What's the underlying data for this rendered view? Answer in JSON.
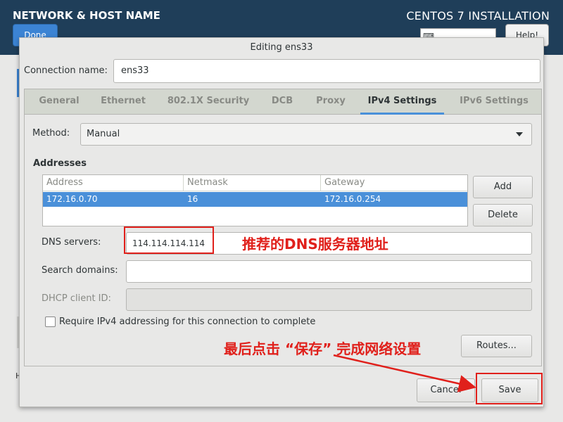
{
  "header": {
    "title": "NETWORK & HOST NAME",
    "done_label": "Done",
    "installer_label": "CENTOS 7 INSTALLATION",
    "help_label": "Help!",
    "bg_h": "H"
  },
  "dialog": {
    "title": "Editing ens33",
    "connection_name_label": "Connection name:",
    "connection_name_value": "ens33",
    "tabs": [
      "General",
      "Ethernet",
      "802.1X Security",
      "DCB",
      "Proxy",
      "IPv4 Settings",
      "IPv6 Settings"
    ],
    "active_tab": "IPv4 Settings",
    "method_label": "Method:",
    "method_value": "Manual",
    "addresses_title": "Addresses",
    "addresses": {
      "columns": [
        "Address",
        "Netmask",
        "Gateway"
      ],
      "rows": [
        [
          "172.16.0.70",
          "16",
          "172.16.0.254"
        ]
      ]
    },
    "add_label": "Add",
    "delete_label": "Delete",
    "dns_label": "DNS servers:",
    "dns_value": "114.114.114.114",
    "search_label": "Search domains:",
    "search_value": "",
    "dhcp_label": "DHCP client ID:",
    "dhcp_value": "",
    "require_ipv4_label": "Require IPv4 addressing for this connection to complete",
    "require_ipv4_checked": false,
    "routes_label": "Routes...",
    "cancel_label": "Cancel",
    "save_label": "Save"
  },
  "annotations": {
    "dns_note": "推荐的DNS服务器地址",
    "save_note": "最后点击 “保存” 完成网络设置"
  },
  "colors": {
    "accent": "#4a90d9",
    "annotation": "#e0201b",
    "header_bg": "#1f3e59"
  }
}
